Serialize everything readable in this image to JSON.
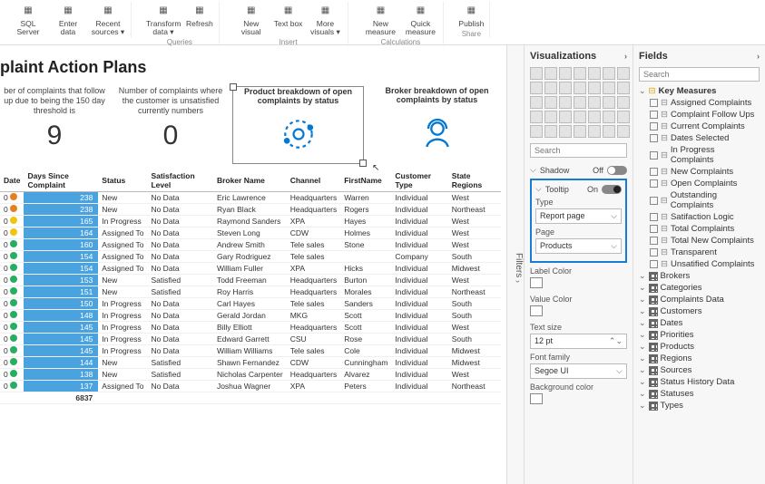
{
  "ribbon": {
    "groups": [
      {
        "label": "",
        "items": [
          {
            "name": "sql-server",
            "label": "SQL Server"
          },
          {
            "name": "enter-data",
            "label": "Enter data"
          },
          {
            "name": "recent-sources",
            "label": "Recent sources ▾"
          }
        ]
      },
      {
        "label": "Queries",
        "items": [
          {
            "name": "transform-data",
            "label": "Transform data ▾"
          },
          {
            "name": "refresh",
            "label": "Refresh"
          }
        ]
      },
      {
        "label": "Insert",
        "items": [
          {
            "name": "new-visual",
            "label": "New visual"
          },
          {
            "name": "text-box",
            "label": "Text box"
          },
          {
            "name": "more-visuals",
            "label": "More visuals ▾"
          }
        ]
      },
      {
        "label": "Calculations",
        "items": [
          {
            "name": "new-measure",
            "label": "New measure"
          },
          {
            "name": "quick-measure",
            "label": "Quick measure"
          }
        ]
      },
      {
        "label": "Share",
        "items": [
          {
            "name": "publish",
            "label": "Publish"
          }
        ]
      }
    ]
  },
  "report": {
    "title": "plaint Action Plans",
    "kpis": [
      {
        "desc": "ber of complaints that follow up due to being the 150 day threshold is",
        "val": "9"
      },
      {
        "desc": "Number of complaints where the customer is unsatisfied currently numbers",
        "val": "0"
      }
    ],
    "charts": [
      {
        "title": "Product breakdown of open complaints by status",
        "icon": "gear"
      },
      {
        "title": "Broker breakdown of open complaints by status",
        "icon": "person"
      }
    ],
    "table": {
      "cols": [
        "Date",
        "Days Since Complaint",
        "Status",
        "Satisfaction Level",
        "Broker Name",
        "Channel",
        "FirstName",
        "Customer Type",
        "State Regions"
      ],
      "rows": [
        [
          "0",
          "238",
          "New",
          "No Data",
          "Eric Lawrence",
          "Headquarters",
          "Warren",
          "Individual",
          "West",
          "#e67e22"
        ],
        [
          "0",
          "238",
          "New",
          "No Data",
          "Ryan Black",
          "Headquarters",
          "Rogers",
          "Individual",
          "Northeast",
          "#e67e22"
        ],
        [
          "0",
          "165",
          "In Progress",
          "No Data",
          "Raymond Sanders",
          "XPA",
          "Hayes",
          "Individual",
          "West",
          "#f1c40f"
        ],
        [
          "0",
          "164",
          "Assigned To",
          "No Data",
          "Steven Long",
          "CDW",
          "Holmes",
          "Individual",
          "West",
          "#f1c40f"
        ],
        [
          "0",
          "160",
          "Assigned To",
          "No Data",
          "Andrew Smith",
          "Tele sales",
          "Stone",
          "Individual",
          "West",
          "#27ae60"
        ],
        [
          "0",
          "154",
          "Assigned To",
          "No Data",
          "Gary Rodriguez",
          "Tele sales",
          "",
          "Company",
          "South",
          "#27ae60"
        ],
        [
          "0",
          "154",
          "Assigned To",
          "No Data",
          "William Fuller",
          "XPA",
          "Hicks",
          "Individual",
          "Midwest",
          "#27ae60"
        ],
        [
          "0",
          "153",
          "New",
          "Satisfied",
          "Todd Freeman",
          "Headquarters",
          "Burton",
          "Individual",
          "West",
          "#27ae60"
        ],
        [
          "0",
          "151",
          "New",
          "Satisfied",
          "Roy Harris",
          "Headquarters",
          "Morales",
          "Individual",
          "Northeast",
          "#27ae60"
        ],
        [
          "0",
          "150",
          "In Progress",
          "No Data",
          "Carl Hayes",
          "Tele sales",
          "Sanders",
          "Individual",
          "South",
          "#27ae60"
        ],
        [
          "0",
          "148",
          "In Progress",
          "No Data",
          "Gerald Jordan",
          "MKG",
          "Scott",
          "Individual",
          "South",
          "#27ae60"
        ],
        [
          "0",
          "145",
          "In Progress",
          "No Data",
          "Billy Elliott",
          "Headquarters",
          "Scott",
          "Individual",
          "West",
          "#27ae60"
        ],
        [
          "0",
          "145",
          "In Progress",
          "No Data",
          "Edward Garrett",
          "CSU",
          "Rose",
          "Individual",
          "South",
          "#27ae60"
        ],
        [
          "0",
          "145",
          "In Progress",
          "No Data",
          "William Williams",
          "Tele sales",
          "Cole",
          "Individual",
          "Midwest",
          "#27ae60"
        ],
        [
          "0",
          "144",
          "New",
          "Satisfied",
          "Shawn Fernandez",
          "CDW",
          "Cunningham",
          "Individual",
          "Midwest",
          "#27ae60"
        ],
        [
          "0",
          "138",
          "New",
          "Satisfied",
          "Nicholas Carpenter",
          "Headquarters",
          "Alvarez",
          "Individual",
          "West",
          "#27ae60"
        ],
        [
          "0",
          "137",
          "Assigned To",
          "No Data",
          "Joshua Wagner",
          "XPA",
          "Peters",
          "Individual",
          "Northeast",
          "#27ae60"
        ]
      ],
      "total": "6837"
    }
  },
  "vizpane": {
    "title": "Visualizations",
    "search_ph": "Search",
    "shadow_label": "Shadow",
    "shadow_state": "Off",
    "tooltip_label": "Tooltip",
    "tooltip_state": "On",
    "type_label": "Type",
    "type_value": "Report page",
    "page_label": "Page",
    "page_value": "Products",
    "labelcolor": "Label Color",
    "valuecolor": "Value Color",
    "textsize_label": "Text size",
    "textsize_value": "12 pt",
    "font_label": "Font family",
    "font_value": "Segoe UI",
    "bg_label": "Background color"
  },
  "fields": {
    "title": "Fields",
    "search_ph": "Search",
    "key_measures": {
      "label": "Key Measures",
      "items": [
        "Assigned Complaints",
        "Complaint Follow Ups",
        "Current Complaints",
        "Dates Selected",
        "In Progress Complaints",
        "New Complaints",
        "Open Complaints",
        "Outstanding Complaints",
        "Satifaction Logic",
        "Total Complaints",
        "Total New Complaints",
        "Transparent",
        "Unsatified Complaints"
      ]
    },
    "tables": [
      "Brokers",
      "Categories",
      "Complaints Data",
      "Customers",
      "Dates",
      "Priorities",
      "Products",
      "Regions",
      "Sources",
      "Status History Data",
      "Statuses",
      "Types"
    ]
  },
  "filters_label": "Filters"
}
